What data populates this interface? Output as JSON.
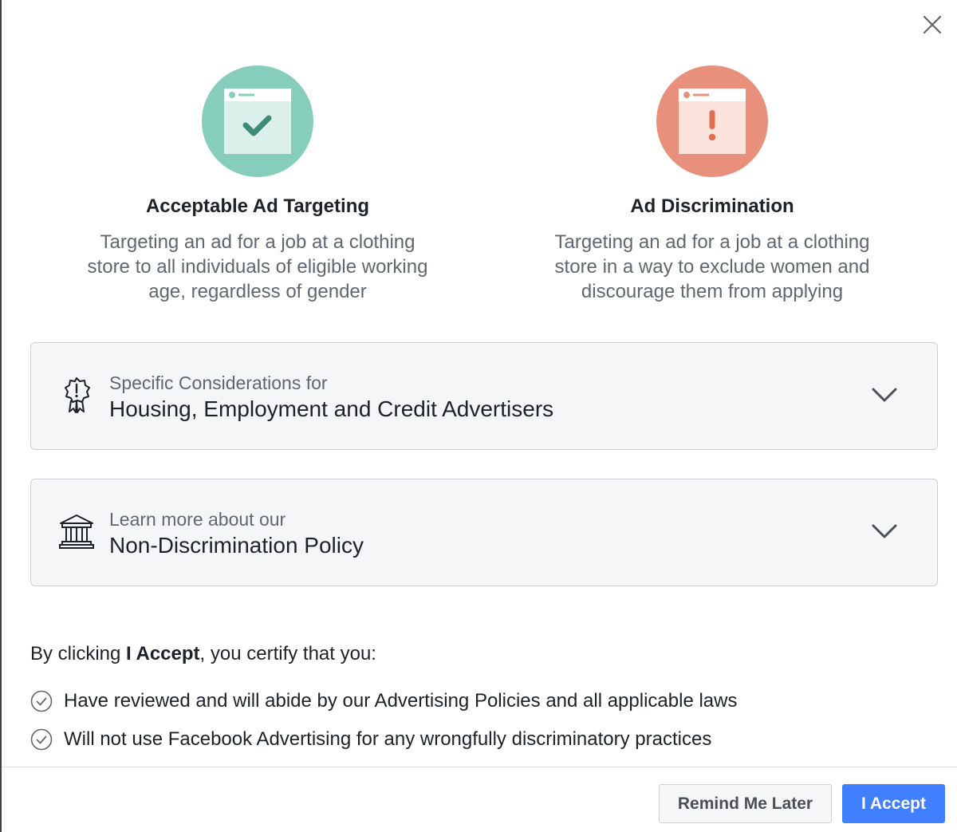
{
  "colors": {
    "good_badge": "#86cebb",
    "bad_badge": "#e8907b",
    "accept_button": "#4080ff"
  },
  "dialog": {
    "close_icon": "close-icon"
  },
  "examples": {
    "good": {
      "icon": "browser-window-check-icon",
      "title": "Acceptable Ad Targeting",
      "description": "Targeting an ad for a job at a clothing store to all individuals of eligible working age, regardless of gender"
    },
    "bad": {
      "icon": "browser-window-exclamation-icon",
      "title": "Ad Discrimination",
      "description": "Targeting an ad for a job at a clothing store in a way to exclude women and discourage them from applying"
    }
  },
  "accordions": [
    {
      "icon": "ribbon-alert-icon",
      "subtitle": "Specific Considerations for",
      "title": "Housing, Employment and Credit Advertisers"
    },
    {
      "icon": "building-columns-icon",
      "subtitle": "Learn more about our",
      "title": "Non-Discrimination Policy"
    }
  ],
  "certify": {
    "prefix": "By clicking ",
    "bold": "I Accept",
    "suffix": ", you certify that you:"
  },
  "checklist": [
    "Have reviewed and will abide by our Advertising Policies and all applicable laws",
    "Will not use Facebook Advertising for any wrongfully discriminatory practices"
  ],
  "footer": {
    "remind_label": "Remind Me Later",
    "accept_label": "I Accept"
  }
}
